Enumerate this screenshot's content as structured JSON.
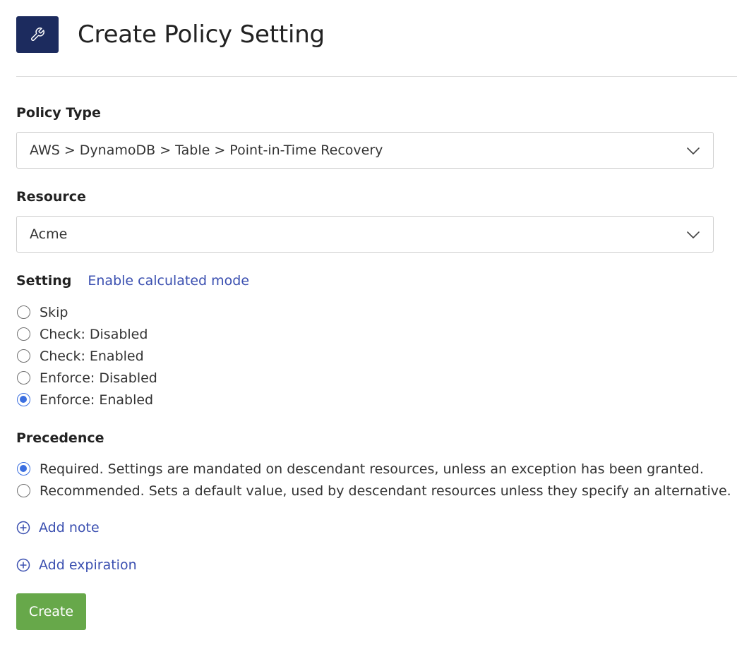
{
  "header": {
    "title": "Create Policy Setting",
    "icon": "wrench-icon",
    "icon_bg": "#1c2b5e"
  },
  "policy_type": {
    "label": "Policy Type",
    "value": "AWS > DynamoDB > Table > Point-in-Time Recovery"
  },
  "resource": {
    "label": "Resource",
    "value": "Acme"
  },
  "setting": {
    "label": "Setting",
    "calc_link": "Enable calculated mode",
    "options": [
      {
        "label": "Skip",
        "checked": false
      },
      {
        "label": "Check: Disabled",
        "checked": false
      },
      {
        "label": "Check: Enabled",
        "checked": false
      },
      {
        "label": "Enforce: Disabled",
        "checked": false
      },
      {
        "label": "Enforce: Enabled",
        "checked": true
      }
    ]
  },
  "precedence": {
    "label": "Precedence",
    "options": [
      {
        "label": "Required. Settings are mandated on descendant resources, unless an exception has been granted.",
        "checked": true
      },
      {
        "label": "Recommended. Sets a default value, used by descendant resources unless they specify an alternative.",
        "checked": false
      }
    ]
  },
  "actions": {
    "add_note": "Add note",
    "add_expiration": "Add expiration",
    "create": "Create"
  },
  "colors": {
    "link": "#3a4fb0",
    "radio_checked": "#3b6fe0",
    "create_button": "#67a84a"
  }
}
